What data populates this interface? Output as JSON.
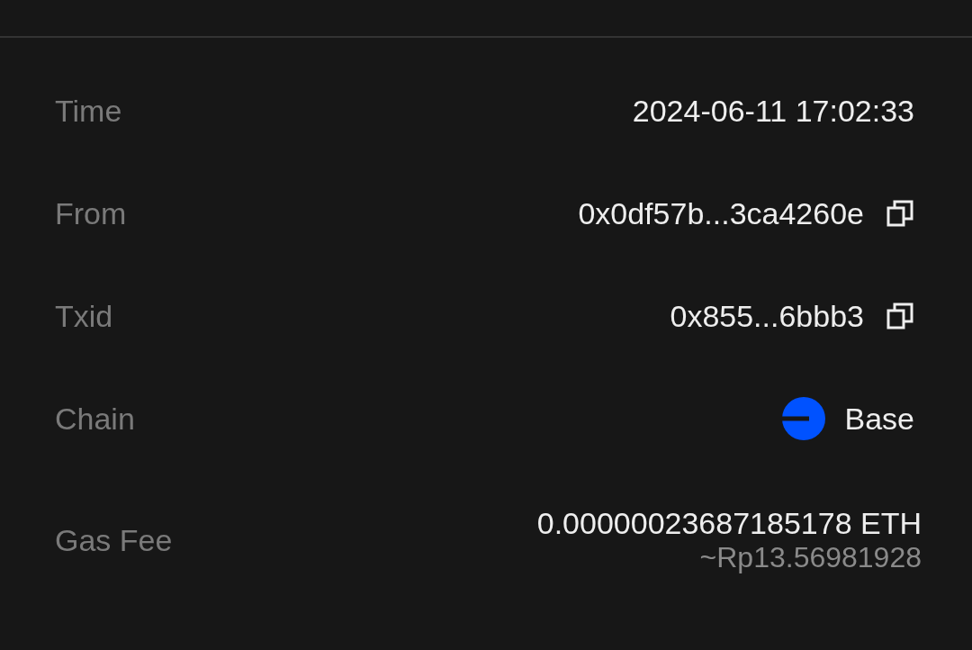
{
  "details": [
    {
      "kind": "text",
      "label": "Time",
      "value": "2024-06-11 17:02:33"
    },
    {
      "kind": "copy",
      "label": "From",
      "value": "0x0df57b...3ca4260e"
    },
    {
      "kind": "copy",
      "label": "Txid",
      "value": "0x855...6bbb3"
    },
    {
      "kind": "chain",
      "label": "Chain",
      "value": "Base",
      "color": "#0052ff"
    },
    {
      "kind": "fee",
      "label": "Gas Fee",
      "value": "0.00000023687185178 ETH",
      "subvalue": "~Rp13.56981928"
    }
  ]
}
